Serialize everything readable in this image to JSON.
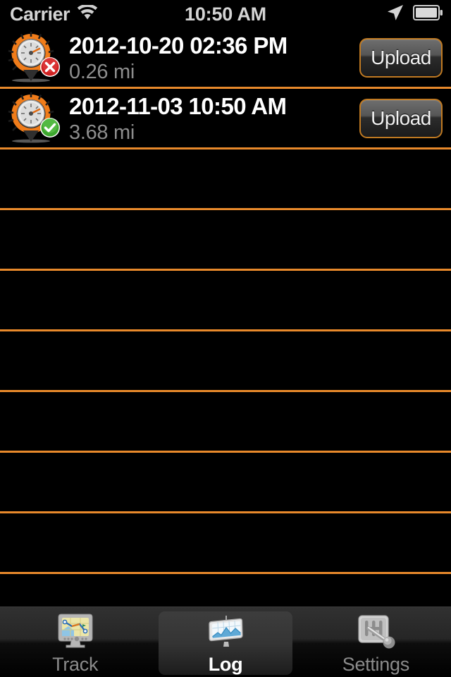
{
  "status_bar": {
    "carrier": "Carrier",
    "wifi_icon": "wifi-icon",
    "time": "10:50 AM",
    "location_icon": "location-arrow-icon",
    "battery_icon": "battery-icon"
  },
  "colors": {
    "separator_orange": "#e8892b",
    "background": "#000000",
    "primary_text": "#ffffff",
    "secondary_text": "#8d8d8d",
    "button_border": "#c07a22",
    "tab_inactive": "#8b8b8b"
  },
  "list": {
    "rows": [
      {
        "icon": "gps-gauge-pin-icon",
        "badge": "error-x-badge",
        "date": "2012-10-20 02:36 PM",
        "distance": "0.26 mi",
        "button_label": "Upload"
      },
      {
        "icon": "gps-gauge-pin-icon",
        "badge": "success-check-badge",
        "date": "2012-11-03 10:50 AM",
        "distance": "3.68 mi",
        "button_label": "Upload"
      }
    ],
    "empty_row_count": 7
  },
  "tab_bar": {
    "tabs": [
      {
        "label": "Track",
        "icon": "gps-navigator-icon",
        "selected": false
      },
      {
        "label": "Log",
        "icon": "chart-billboard-icon",
        "selected": true
      },
      {
        "label": "Settings",
        "icon": "gear-shifter-icon",
        "selected": false
      }
    ]
  }
}
